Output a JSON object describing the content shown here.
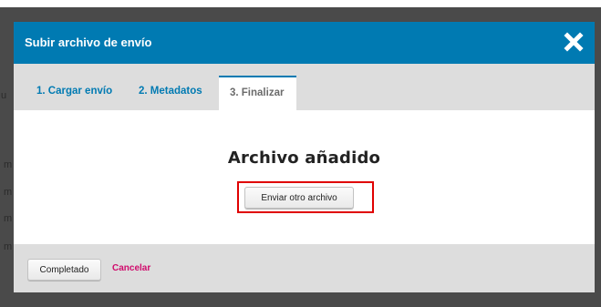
{
  "modal": {
    "title": "Subir archivo de envío",
    "close_icon": "close-x-icon"
  },
  "tabs": [
    {
      "label": "1. Cargar envío",
      "active": false
    },
    {
      "label": "2. Metadatos",
      "active": false
    },
    {
      "label": "3. Finalizar",
      "active": true
    }
  ],
  "body": {
    "heading": "Archivo añadido",
    "upload_another_label": "Enviar otro archivo"
  },
  "footer": {
    "done_label": "Completado",
    "cancel_label": "Cancelar"
  },
  "background": {
    "fragments": [
      "u",
      "m",
      "m",
      "m",
      "m"
    ]
  },
  "colors": {
    "header": "#007ab2",
    "tab_link": "#007ab2",
    "active_tab_text": "#6b6b6b",
    "cancel_link": "#d00a6c",
    "highlight_border": "#e00000",
    "overlay": "#4a4a4a",
    "bars": "#dddddd"
  }
}
